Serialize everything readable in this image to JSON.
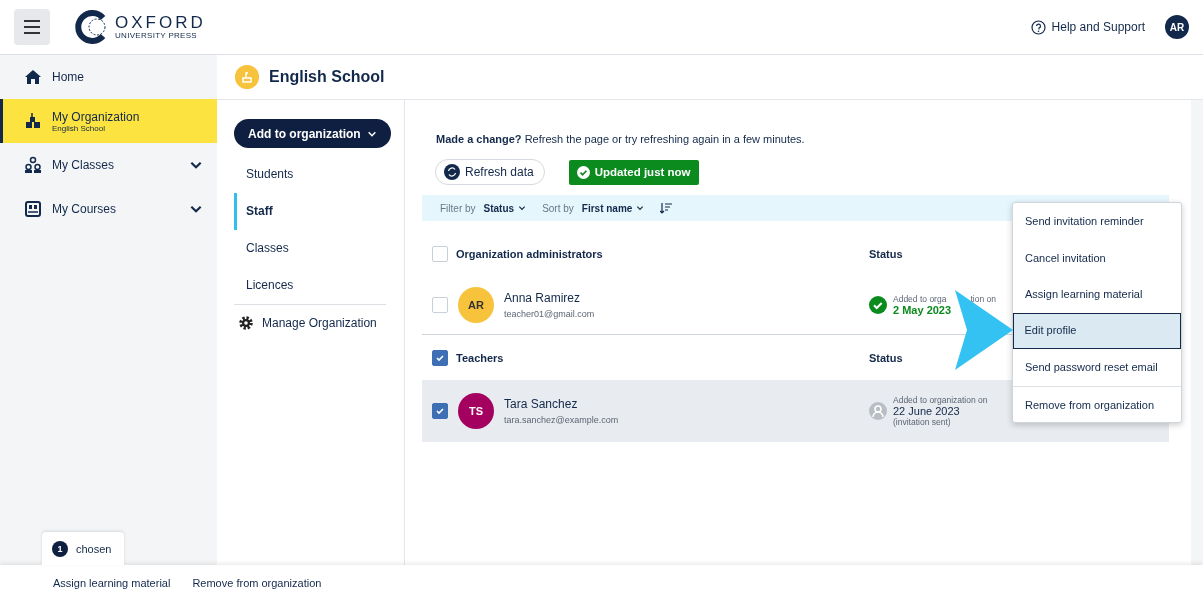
{
  "header": {
    "logo_title": "OXFORD",
    "logo_subtitle": "UNIVERSITY PRESS",
    "help": "Help and Support",
    "avatar": "AR"
  },
  "sidebar": {
    "items": [
      {
        "label": "Home",
        "selected": false
      },
      {
        "label": "My Organization",
        "sublabel": "English School",
        "selected": true
      },
      {
        "label": "My Classes",
        "selected": false,
        "expanded": false
      },
      {
        "label": "My Courses",
        "selected": false,
        "expanded": false
      }
    ]
  },
  "page_title": "English School",
  "subnav": {
    "add_button": "Add to organization",
    "items": [
      {
        "label": "Students",
        "selected": false
      },
      {
        "label": "Staff",
        "selected": true
      },
      {
        "label": "Classes",
        "selected": false
      },
      {
        "label": "Licences",
        "selected": false
      }
    ],
    "manage": "Manage Organization"
  },
  "notice": "**Made a change?**  Refresh the page or try refreshing again in a few minutes.",
  "refresh_button": "Refresh data",
  "updated_badge": "Updated just now",
  "filter": {
    "filter_label": "Filter by",
    "filter_value": "Status",
    "sort_label": "Sort by",
    "sort_value": "First name"
  },
  "groups": [
    {
      "title": "Organization administrators",
      "checked": false,
      "status_heading": "Status",
      "members": [
        {
          "initials": "AR",
          "color": "#f8c33c",
          "name": "Anna Ramirez",
          "email": "teacher01@gmail.com",
          "checked": false,
          "selected": false,
          "kind": "active",
          "status_label_parts": [
            "Added to orga",
            "tion on"
          ],
          "date": "2 May 2023"
        }
      ]
    },
    {
      "title": "Teachers",
      "checked": true,
      "status_heading": "Status",
      "members": [
        {
          "initials": "TS",
          "color": "#a3005f",
          "name": "Tara Sanchez",
          "email": "tara.sanchez@example.com",
          "checked": true,
          "selected": true,
          "kind": "invited",
          "status_label": "Added to organization on",
          "date": "22 June 2023",
          "note": "(invitation sent)"
        }
      ]
    }
  ],
  "menu": {
    "items": [
      {
        "label": "Send invitation reminder",
        "selected": false
      },
      {
        "label": "Cancel invitation",
        "selected": false
      },
      {
        "label": "Assign learning material",
        "selected": false
      },
      {
        "label": "Edit profile",
        "selected": true
      },
      {
        "label": "Send password reset email",
        "selected": false
      },
      {
        "label": "Remove from organization",
        "selected": false
      }
    ]
  },
  "selection_bar": {
    "count": "1",
    "label": "chosen",
    "actions": [
      "Assign learning material",
      "Remove from organization"
    ]
  }
}
